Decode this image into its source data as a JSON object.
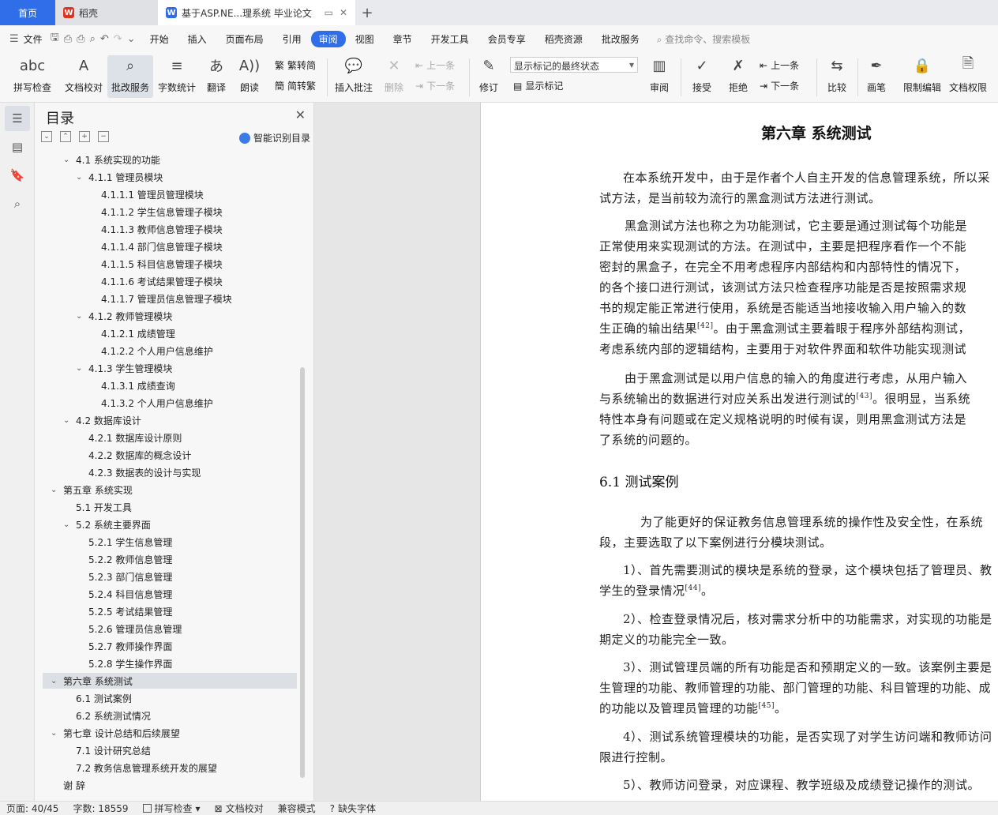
{
  "tabs": {
    "home": "首页",
    "daoke": "稻壳",
    "doc": "基于ASP.NE...理系统 毕业论文"
  },
  "menu": {
    "file": "文件",
    "items": [
      "开始",
      "插入",
      "页面布局",
      "引用",
      "审阅",
      "视图",
      "章节",
      "开发工具",
      "会员专享",
      "稻壳资源",
      "批改服务"
    ],
    "active_index": 4,
    "search": "查找命令、搜索模板"
  },
  "ribbon": {
    "spellcheck": "拼写检查",
    "doc_check": "文档校对",
    "review_service": "批改服务",
    "word_count": "字数统计",
    "translate": "翻译",
    "read_aloud": "朗读",
    "trad_to_simp": "繁转简",
    "simp_to_trad": "简转繁",
    "insert_comment": "插入批注",
    "delete": "删除",
    "prev_comment": "上一条",
    "next_comment": "下一条",
    "track_changes": "修订",
    "markup_state": "显示标记的最终状态",
    "show_markup": "显示标记",
    "review": "审阅",
    "accept": "接受",
    "reject": "拒绝",
    "prev_change": "上一条",
    "next_change": "下一条",
    "compare": "比较",
    "pen": "画笔",
    "restrict_edit": "限制编辑",
    "doc_permission": "文档权限"
  },
  "toc": {
    "title": "目录",
    "smart": "智能识别目录",
    "items": [
      {
        "text": "4.1  系统实现的功能",
        "level": 1,
        "chev": true
      },
      {
        "text": "4.1.1 管理员模块",
        "level": 2,
        "chev": true
      },
      {
        "text": "4.1.1.1 管理员管理模块",
        "level": 3
      },
      {
        "text": "4.1.1.2  学生信息管理子模块",
        "level": 3
      },
      {
        "text": "4.1.1.3  教师信息管理子模块",
        "level": 3
      },
      {
        "text": "4.1.1.4  部门信息管理子模块",
        "level": 3
      },
      {
        "text": "4.1.1.5  科目信息管理子模块",
        "level": 3
      },
      {
        "text": "4.1.1.6  考试结果管理子模块",
        "level": 3
      },
      {
        "text": "4.1.1.7  管理员信息管理子模块",
        "level": 3
      },
      {
        "text": "4.1.2  教师管理模块",
        "level": 2,
        "chev": true
      },
      {
        "text": "4.1.2.1  成绩管理",
        "level": 3
      },
      {
        "text": "4.1.2.2 个人用户信息维护",
        "level": 3
      },
      {
        "text": "4.1.3  学生管理模块",
        "level": 2,
        "chev": true
      },
      {
        "text": "4.1.3.1  成绩查询",
        "level": 3
      },
      {
        "text": "4.1.3.2 个人用户信息维护",
        "level": 3
      },
      {
        "text": "4.2  数据库设计",
        "level": 1,
        "chev": true
      },
      {
        "text": "4.2.1    数据库设计原则",
        "level": 2
      },
      {
        "text": "4.2.2  数据库的概念设计",
        "level": 2
      },
      {
        "text": "4.2.3  数据表的设计与实现",
        "level": 2
      },
      {
        "text": "第五章  系统实现",
        "level": 0,
        "chev": true
      },
      {
        "text": "5.1  开发工具",
        "level": 1
      },
      {
        "text": "5.2 系统主要界面",
        "level": 1,
        "chev": true
      },
      {
        "text": "5.2.1  学生信息管理",
        "level": 2
      },
      {
        "text": "5.2.2  教师信息管理",
        "level": 2
      },
      {
        "text": "5.2.3  部门信息管理",
        "level": 2
      },
      {
        "text": "5.2.4  科目信息管理",
        "level": 2
      },
      {
        "text": "5.2.5  考试结果管理",
        "level": 2
      },
      {
        "text": "5.2.6 管理员信息管理",
        "level": 2
      },
      {
        "text": "5.2.7 教师操作界面",
        "level": 2
      },
      {
        "text": "5.2.8 学生操作界面",
        "level": 2
      },
      {
        "text": "第六章  系统测试",
        "level": 0,
        "chev": true,
        "selected": true
      },
      {
        "text": "6.1  测试案例",
        "level": 1
      },
      {
        "text": "6.2  系统测试情况",
        "level": 1
      },
      {
        "text": "第七章  设计总结和后续展望",
        "level": 0,
        "chev": true
      },
      {
        "text": "7.1  设计研究总结",
        "level": 1
      },
      {
        "text": "7.2  教务信息管理系统开发的展望",
        "level": 1
      },
      {
        "text": "谢  辞",
        "level": 0
      }
    ]
  },
  "document": {
    "chapter_title": "第六章  系统测试",
    "para1": [
      "在本系统开发中，由于是作者个人自主开发的信息管理系统，所以采",
      "试方法，是当前较为流行的黑盒测试方法进行测试。"
    ],
    "para2": [
      "黑盒测试方法也称之为功能测试，它主要是通过测试每个功能是",
      "正常使用来实现测试的方法。在测试中，主要是把程序看作一个不能",
      "密封的黑盒子，在完全不用考虑程序内部结构和内部特性的情况下，",
      "的各个接口进行测试，该测试方法只检查程序功能是否是按照需求规",
      "书的规定能正常进行使用，系统是否能适当地接收输入用户输入的数",
      "生正确的输出结果",
      "。由于黑盒测试主要着眼于程序外部结构测试，",
      "考虑系统内部的逻辑结构，主要用于对软件界面和软件功能实现测试"
    ],
    "ref42": "[42]",
    "para3": [
      "由于黑盒测试是以用户信息的输入的角度进行考虑，从用户输入",
      "与系统输出的数据进行对应关系出发进行测试的",
      "。很明显，当系统",
      "特性本身有问题或在定义规格说明的时候有误，则用黑盒测试方法是",
      "了系统的问题的。"
    ],
    "ref43": "[43]",
    "section_title": "6.1  测试案例",
    "para4": [
      "为了能更好的保证教务信息管理系统的操作性及安全性，在系统",
      "段，主要选取了以下案例进行分模块测试。"
    ],
    "item1": [
      "1）、首先需要测试的模块是系统的登录，这个模块包括了管理员、教",
      "学生的登录情况",
      "。"
    ],
    "ref44": "[44]",
    "item2": [
      "2）、检查登录情况后，核对需求分析中的功能需求，对实现的功能是",
      "期定义的功能完全一致。"
    ],
    "item3": [
      "3）、测试管理员端的所有功能是否和预期定义的一致。该案例主要是",
      "生管理的功能、教师管理的功能、部门管理的功能、科目管理的功能、成",
      "的功能以及管理员管理的功能",
      "。"
    ],
    "ref45": "[45]",
    "item4": [
      "4）、测试系统管理模块的功能，是否实现了对学生访问端和教师访问",
      "限进行控制。"
    ],
    "item5": "5）、教师访问登录，对应课程、教学班级及成绩登记操作的测试。"
  },
  "status": {
    "page": "页面: 40/45",
    "words": "字数: 18559",
    "spellcheck": "拼写检查",
    "doccheck": "文档校对",
    "compat": "兼容模式",
    "missing_font": "缺失字体"
  }
}
